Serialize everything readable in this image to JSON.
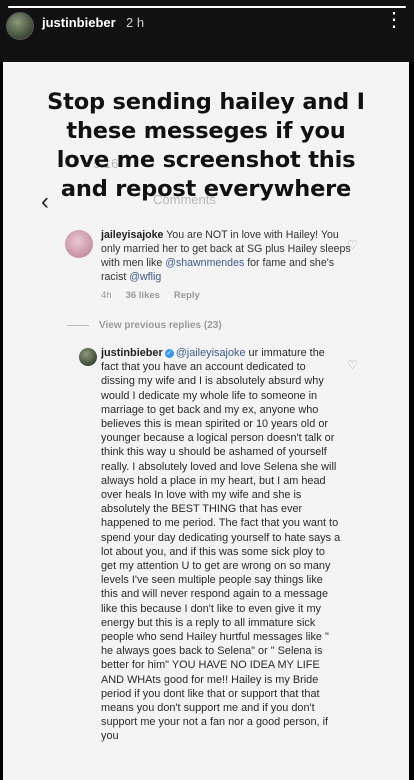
{
  "story": {
    "username": "justinbieber",
    "time": "2 h",
    "progress": 1.0
  },
  "headline": {
    "line1": "Stop sending hailey and I",
    "line2": "these messeges if you",
    "line3": "love me screenshot this",
    "line4": "and repost everywhere"
  },
  "header_ghost": {
    "left": "5:16",
    "center": "Comments"
  },
  "comment1": {
    "username": "jailey",
    "username_suffix": "isajoke",
    "text_before": " You are NOT in love with Hailey! You only married her to get back at SG plus Hailey sleeps with men like ",
    "mention1": "@shawnmendes",
    "text_middle": " for fame and she's racist ",
    "mention2": "@wflig",
    "age": "4h",
    "likes": "36 likes",
    "reply": "Reply"
  },
  "view_previous": "View previous replies (23)",
  "comment2": {
    "username": "justinbieber",
    "mention": "@jaileyisajoke",
    "text": " ur immature the fact that you have an account dedicated to dissing my wife and I is absolutely absurd why would I dedicate my whole life to someone in marriage to get back and my ex, anyone who believes this is mean spirited or 10 years old or younger because a logical person doesn't talk or think this way u should be ashamed of yourself really.  I absolutely loved and love Selena she will always hold a place in my heart, but I am head over heals In love with my wife and she is absolutely the BEST THING that has ever happened to me period. The fact that you want to spend your day dedicating yourself to hate says a lot about you, and if this was some sick ploy to get my attention U to get are wrong on so many levels I've seen multiple people say things like this and will never respond again to a message like this because I don't like to even give it my energy but this is a reply to all immature sick people who send Hailey hurtful messages like \" he always goes back to Selena\" or \" Selena is better for him\" YOU HAVE NO IDEA MY LIFE AND WHAts good for me!! Hailey is my Bride period if you dont like that or support that that means you don't support me and if you don't support me your not a fan nor a good person, if you"
  },
  "icons": {
    "heart": "♡",
    "back": "‹",
    "more": "⋮"
  },
  "colors": {
    "mention": "#3d5a8a",
    "verified": "#3897f0"
  }
}
